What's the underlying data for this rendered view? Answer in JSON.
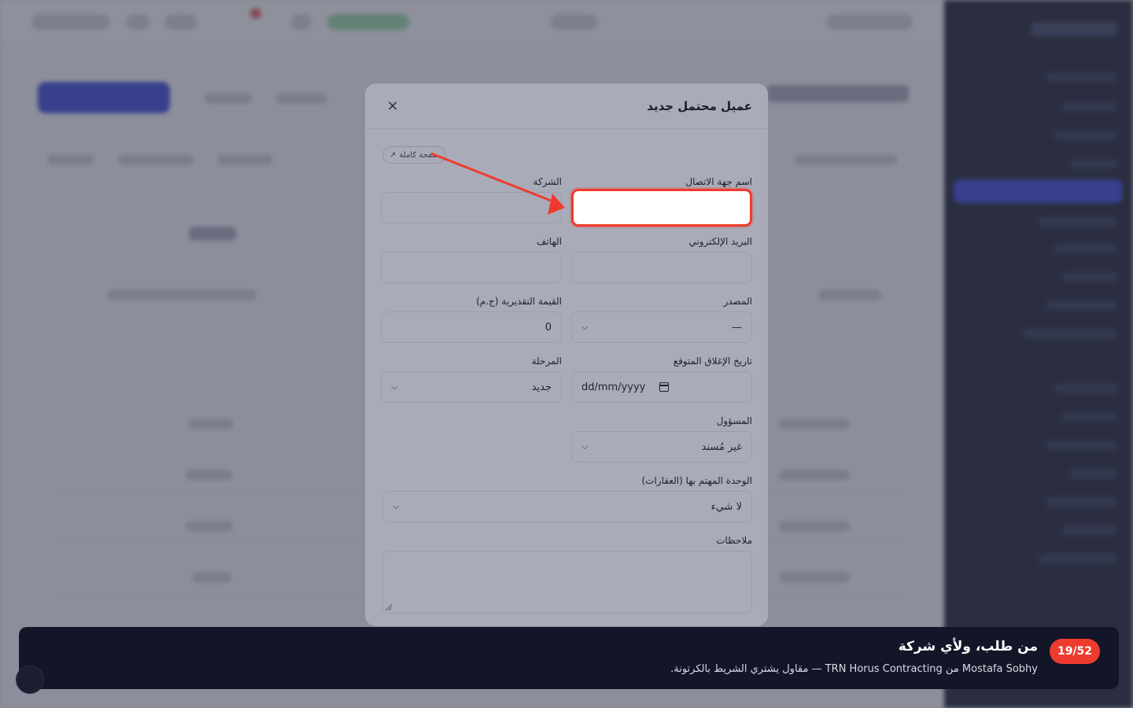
{
  "modal": {
    "title": "عميل محتمل جديد",
    "close_glyph": "×",
    "fullpage_label": "صفحة كاملة",
    "fullpage_icon": "↗",
    "fields": {
      "contact_name": {
        "label": "اسم جهة الاتصال",
        "value": ""
      },
      "company": {
        "label": "الشركة",
        "value": ""
      },
      "email": {
        "label": "البريد الإلكتروني",
        "value": ""
      },
      "phone": {
        "label": "الهاتف",
        "value": ""
      },
      "source": {
        "label": "المصدر",
        "value": "—"
      },
      "estimated_value": {
        "label": "القيمة التقديرية (ج.م)",
        "value": "0"
      },
      "expected_close": {
        "label": "تاريخ الإغلاق المتوقع",
        "placeholder": "dd/mm/yyyy"
      },
      "stage": {
        "label": "المرحلة",
        "value": "جديد"
      },
      "owner": {
        "label": "المسؤول",
        "value": "غير مُسند"
      },
      "unit": {
        "label": "الوحدة المهتم بها (العقارات)",
        "value": "لا شيء"
      },
      "notes": {
        "label": "ملاحظات",
        "value": ""
      }
    }
  },
  "banner": {
    "step": "19/52",
    "title": "من طلب، ولأي شركة",
    "subtitle": "Mostafa Sobhy من TRN Horus Contracting — مقاول يشتري الشريط بالكرتونة."
  },
  "colors": {
    "highlight": "#ef3b2f",
    "banner_bg": "#121628",
    "accent": "#3340d6"
  }
}
